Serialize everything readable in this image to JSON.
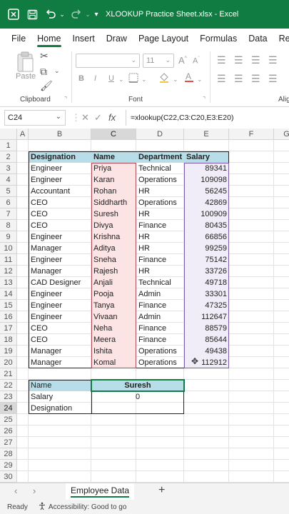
{
  "window": {
    "title": "XLOOKUP Practice Sheet.xlsx  -  Excel"
  },
  "quick_access": {
    "save_icon": "save-icon",
    "undo_icon": "undo-icon",
    "redo_icon": "redo-icon"
  },
  "ribbon": {
    "tabs": [
      "File",
      "Home",
      "Insert",
      "Draw",
      "Page Layout",
      "Formulas",
      "Data",
      "Review"
    ],
    "active_tab": "Home",
    "clipboard_label": "Clipboard",
    "paste_label": "Paste",
    "font_label": "Font",
    "alignment_label": "Alig",
    "font_size": "11",
    "bold": "B",
    "italic": "I",
    "underline": "U"
  },
  "formula_bar": {
    "name_box": "C24",
    "formula": "=xlookup(C22,C3:C20,E3:E20)",
    "cancel": "✕",
    "enter": "✓",
    "fx": "fx"
  },
  "columns": [
    "A",
    "B",
    "C",
    "D",
    "E",
    "F",
    "G"
  ],
  "rows": [
    "1",
    "2",
    "3",
    "4",
    "5",
    "6",
    "7",
    "8",
    "9",
    "10",
    "11",
    "12",
    "13",
    "14",
    "15",
    "16",
    "17",
    "18",
    "19",
    "20",
    "21",
    "22",
    "23",
    "24",
    "25",
    "26",
    "27",
    "28",
    "29",
    "30"
  ],
  "table": {
    "headers": [
      "Designation",
      "Name",
      "Department",
      "Salary"
    ],
    "rows": [
      [
        "Engineer",
        "Priya",
        "Technical",
        "89341"
      ],
      [
        "Engineer",
        "Karan",
        "Operations",
        "109098"
      ],
      [
        "Accountant",
        "Rohan",
        "HR",
        "56245"
      ],
      [
        "CEO",
        "Siddharth",
        "Operations",
        "42869"
      ],
      [
        "CEO",
        "Suresh",
        "HR",
        "100909"
      ],
      [
        "CEO",
        "Divya",
        "Finance",
        "80435"
      ],
      [
        "Engineer",
        "Krishna",
        "HR",
        "66856"
      ],
      [
        "Manager",
        "Aditya",
        "HR",
        "99259"
      ],
      [
        "Engineer",
        "Sneha",
        "Finance",
        "75142"
      ],
      [
        "Manager",
        "Rajesh",
        "HR",
        "33726"
      ],
      [
        "CAD Designer",
        "Anjali",
        "Technical",
        "49718"
      ],
      [
        "Engineer",
        "Pooja",
        "Admin",
        "33301"
      ],
      [
        "Engineer",
        "Tanya",
        "Finance",
        "47325"
      ],
      [
        "Engineer",
        "Vivaan",
        "Admin",
        "112647"
      ],
      [
        "CEO",
        "Neha",
        "Finance",
        "88579"
      ],
      [
        "CEO",
        "Meera",
        "Finance",
        "85644"
      ],
      [
        "Manager",
        "Ishita",
        "Operations",
        "49438"
      ],
      [
        "Manager",
        "Komal",
        "Operations",
        "112912"
      ]
    ]
  },
  "lookup": {
    "name_label": "Name",
    "name_value": "Suresh",
    "salary_label": "Salary",
    "salary_value": "0",
    "designation_label": "Designation",
    "designation_value": ""
  },
  "sheets": {
    "active": "Employee Data",
    "add": "+"
  },
  "status": {
    "ready": "Ready",
    "accessibility": "Accessibility: Good to go"
  },
  "colors": {
    "accent": "#107c41",
    "header_fill": "#b7dee8",
    "name_ref": "#b04a55",
    "salary_ref": "#7c5aa6"
  }
}
